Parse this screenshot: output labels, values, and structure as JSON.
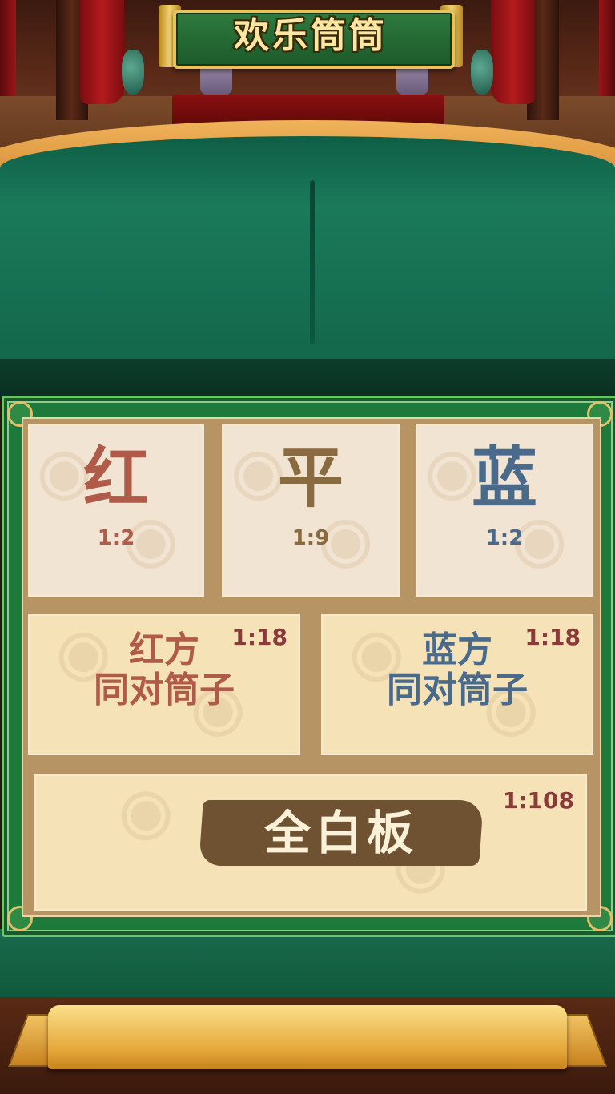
{
  "game": {
    "title": "欢乐筒筒"
  },
  "bets": {
    "red": {
      "label": "红",
      "ratio": "1:2"
    },
    "ping": {
      "label": "平",
      "ratio": "1:9"
    },
    "blue": {
      "label": "蓝",
      "ratio": "1:2"
    },
    "red_pair": {
      "line1": "红方",
      "line2": "同对筒子",
      "ratio": "1:18"
    },
    "blue_pair": {
      "line1": "蓝方",
      "line2": "同对筒子",
      "ratio": "1:18"
    },
    "all_white": {
      "label": "全白板",
      "ratio": "1:108"
    }
  },
  "colors": {
    "red_text": "#b05a4a",
    "ping_text": "#8a6a40",
    "blue_text": "#4a6a8c",
    "felt": "#1a7a5a",
    "board_green": "#1e7a3a"
  }
}
